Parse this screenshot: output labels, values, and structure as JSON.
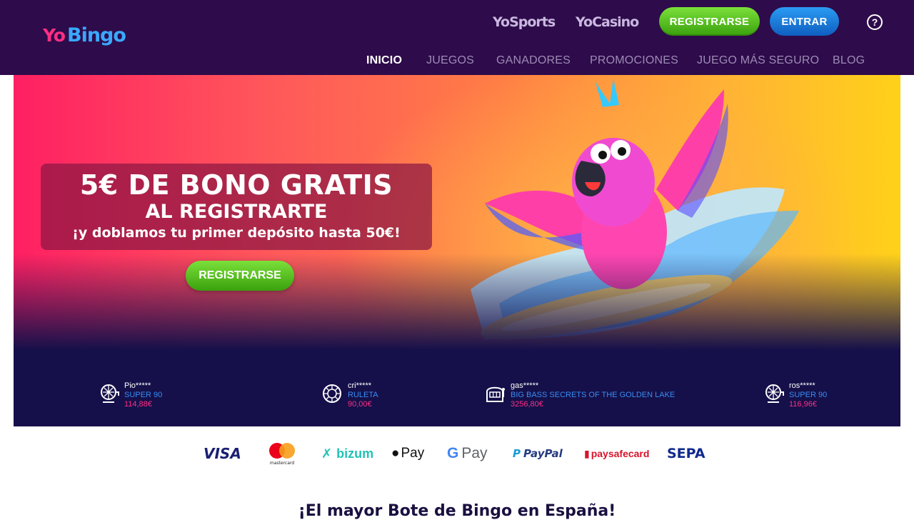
{
  "header": {
    "logo_text": "YoBingo",
    "brand_links": [
      "YoSports",
      "YoCasino"
    ],
    "register_label": "REGISTRARSE",
    "login_label": "ENTRAR",
    "help_label": "?"
  },
  "nav": {
    "items": [
      "INICIO",
      "JUEGOS",
      "GANADORES",
      "PROMOCIONES",
      "JUEGO MÁS SEGURO",
      "BLOG"
    ],
    "active": "INICIO"
  },
  "hero": {
    "line1": "5€ DE BONO GRATIS",
    "line2": "AL REGISTRARTE",
    "line3": "¡y doblamos tu primer depósito hasta 50€!",
    "cta_label": "REGISTRARSE"
  },
  "winners": [
    {
      "name": "Pio*****",
      "game": "SUPER 90",
      "amount": "114,88€",
      "icon": "bingo-cage-icon"
    },
    {
      "name": "cri*****",
      "game": "RULETA",
      "amount": "90,00€",
      "icon": "roulette-icon"
    },
    {
      "name": "gas*****",
      "game": "BIG BASS SECRETS OF THE GOLDEN LAKE",
      "amount": "3256,80€",
      "icon": "slot-machine-icon"
    },
    {
      "name": "ros*****",
      "game": "SUPER 90",
      "amount": "116,96€",
      "icon": "bingo-cage-icon"
    }
  ],
  "payments": {
    "visa": "VISA",
    "mastercard": "mastercard",
    "bizum": "bizum",
    "applepay": "Pay",
    "googlepay": "Pay",
    "paypal": "PayPal",
    "paysafecard": "paysafecard",
    "sepa": "SEPA"
  },
  "bottom": {
    "title": "¡El mayor Bote de Bingo en España!"
  },
  "colors": {
    "header_bg": "#2e0b4a",
    "green_button": "#5bc421",
    "blue_button": "#1a7ad8",
    "winners_bg": "#15104a"
  }
}
